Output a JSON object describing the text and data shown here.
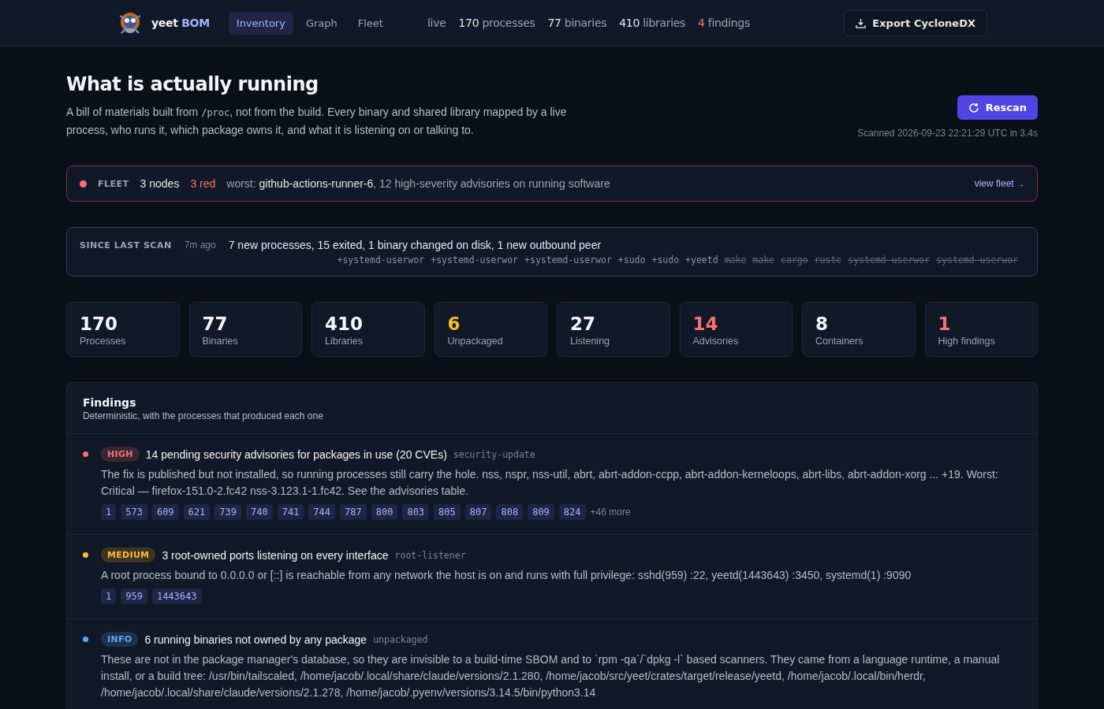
{
  "header": {
    "brand": "yeet",
    "brand_accent": "BOM",
    "nav": [
      {
        "label": "Inventory",
        "selected": true
      },
      {
        "label": "Graph",
        "selected": false
      },
      {
        "label": "Fleet",
        "selected": false
      }
    ],
    "live_label": "live",
    "stats": [
      {
        "text": "**170** processes",
        "alert": false
      },
      {
        "text": "**77** binaries",
        "alert": false
      },
      {
        "text": "**410** libraries",
        "alert": false
      },
      {
        "text": "**4** findings",
        "alert": true
      }
    ],
    "export_button": "Export CycloneDX"
  },
  "hero": {
    "title": "What is actually running",
    "description_before": "A bill of materials built from ",
    "description_code": "/proc",
    "description_after": ", not from the build. Every binary and shared library mapped by a live process, who runs it, which package owns it, and what it is listening on or talking to.",
    "rescan_button": "Rescan",
    "scanned": "Scanned 2026-09-23 22:21:29 UTC in 3.4s"
  },
  "fleet": {
    "alert": true,
    "label": "FLEET",
    "nodes": "3 nodes",
    "red": "3 red",
    "worst_label": "worst:",
    "worst_host": "github-actions-runner-6",
    "worst_rest": ", 12 high-severity advisories on running software",
    "link": "view fleet",
    "link_arrow": "→"
  },
  "since_last_scan": {
    "label": "SINCE LAST SCAN",
    "ago": "7m ago",
    "summary": "7 new processes, 15 exited, 1 binary changed on disk, 1 new outbound peer",
    "changes": [
      {
        "text": "+systemd-userwor",
        "kind": "added"
      },
      {
        "text": "+systemd-userwor",
        "kind": "added"
      },
      {
        "text": "+systemd-userwor",
        "kind": "added"
      },
      {
        "text": "+sudo",
        "kind": "added"
      },
      {
        "text": "+sudo",
        "kind": "added"
      },
      {
        "text": "+yeetd",
        "kind": "added"
      },
      {
        "text": "make",
        "kind": "removed"
      },
      {
        "text": "make",
        "kind": "removed"
      },
      {
        "text": "cargo",
        "kind": "removed"
      },
      {
        "text": "rustc",
        "kind": "removed"
      },
      {
        "text": "systemd-userwor",
        "kind": "removed"
      },
      {
        "text": "systemd-userwor",
        "kind": "removed"
      }
    ]
  },
  "metrics": [
    {
      "value": "170",
      "label": "Processes",
      "color": "#f3f4f6"
    },
    {
      "value": "77",
      "label": "Binaries",
      "color": "#f3f4f6"
    },
    {
      "value": "410",
      "label": "Libraries",
      "color": "#f3f4f6"
    },
    {
      "value": "6",
      "label": "Unpackaged",
      "color": "#fbbf24"
    },
    {
      "value": "27",
      "label": "Listening",
      "color": "#f3f4f6"
    },
    {
      "value": "14",
      "label": "Advisories",
      "color": "#f87171"
    },
    {
      "value": "8",
      "label": "Containers",
      "color": "#f3f4f6"
    },
    {
      "value": "1",
      "label": "High findings",
      "color": "#f87171"
    }
  ],
  "findings": {
    "title": "Findings",
    "subtitle": "Deterministic, with the processes that produced each one",
    "items": [
      {
        "color": "#f87171",
        "badge": "HIGH",
        "title": "14 pending security advisories for packages in use (20 CVEs)",
        "tag": "security-update",
        "description": "The fix is published but not installed, so running processes still carry the hole. nss, nspr, nss-util, abrt, abrt-addon-ccpp, abrt-addon-kerneloops, abrt-libs, abrt-addon-xorg ... +19. Worst: Critical — firefox-151.0-2.fc42 nss-3.123.1-1.fc42. See the advisories table.",
        "pids": [
          "1",
          "573",
          "609",
          "621",
          "739",
          "740",
          "741",
          "744",
          "787",
          "800",
          "803",
          "805",
          "807",
          "808",
          "809",
          "824"
        ],
        "more": "+46 more"
      },
      {
        "color": "#fbbf24",
        "badge": "MEDIUM",
        "title": "3 root-owned ports listening on every interface",
        "tag": "root-listener",
        "description": "A root process bound to 0.0.0.0 or [::] is reachable from any network the host is on and runs with full privilege: sshd(959) :22, yeetd(1443643) :3450, systemd(1) :9090",
        "pids": [
          "1",
          "959",
          "1443643"
        ]
      },
      {
        "color": "#60a5fa",
        "badge": "INFO",
        "title": "6 running binaries not owned by any package",
        "tag": "unpackaged",
        "description": "These are not in the package manager's database, so they are invisible to a build-time SBOM and to `rpm -qa`/`dpkg -l` based scanners. They came from a language runtime, a manual install, or a build tree: /usr/bin/tailscaled, /home/jacob/.local/share/claude/versions/2.1.280, /home/jacob/src/yeet/crates/target/release/yeetd, /home/jacob/.local/bin/herdr, /home/jacob/.local/share/claude/versions/2.1.278, /home/jacob/.pyenv/versions/3.14.5/bin/python3.14"
      }
    ]
  }
}
